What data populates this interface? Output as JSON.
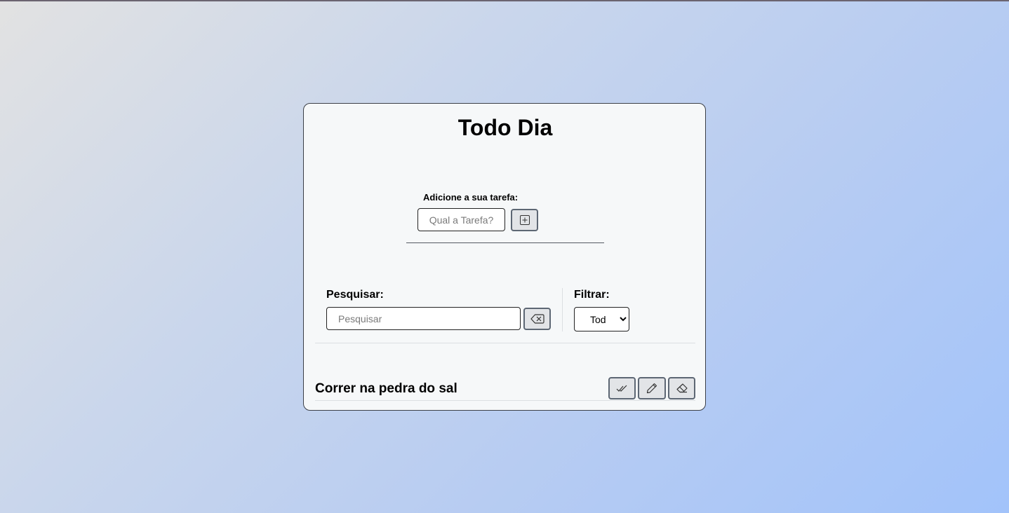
{
  "app": {
    "title": "Todo Dia"
  },
  "add_form": {
    "label": "Adicione a sua tarefa:",
    "placeholder": "Qual a Tarefa?",
    "value": "",
    "add_button_icon": "plus-square-icon"
  },
  "search": {
    "label": "Pesquisar:",
    "placeholder": "Pesquisar",
    "value": "",
    "clear_button_icon": "backspace-icon"
  },
  "filter": {
    "label": "Filtrar:",
    "selected": "Tod",
    "options": [
      "Tod"
    ]
  },
  "todos": [
    {
      "text": "Correr na pedra do sal",
      "actions": [
        "check-double-icon",
        "pencil-icon",
        "eraser-icon"
      ]
    }
  ],
  "colors": {
    "card_background": "#f6f8f9",
    "button_background": "#e2e4e7",
    "button_border": "#5d6774",
    "gradient_start": "#e2e2e2",
    "gradient_end": "#a2c3fa"
  }
}
